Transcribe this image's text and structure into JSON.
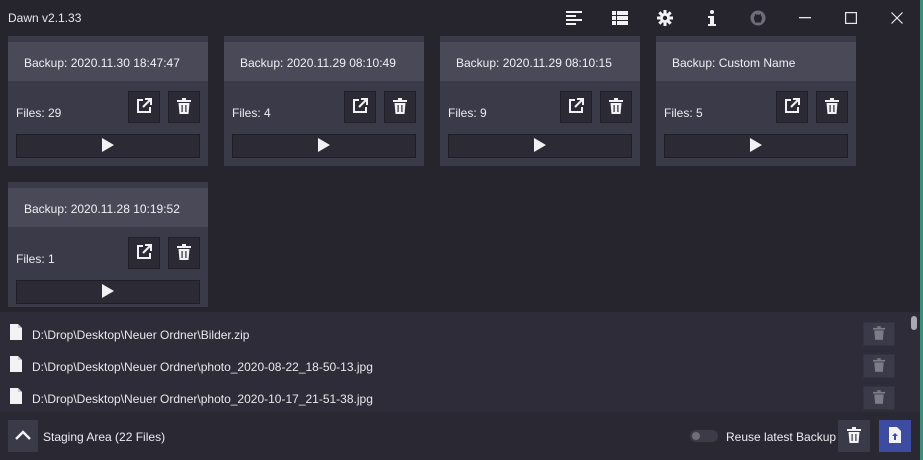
{
  "app": {
    "title": "Dawn v2.1.33"
  },
  "toolbar": {
    "icons": [
      "align-left-icon",
      "list-icon",
      "gear-icon",
      "info-icon",
      "github-icon"
    ]
  },
  "window_controls": [
    "minimize-icon",
    "maximize-icon",
    "close-icon"
  ],
  "backups": [
    {
      "name": "Backup: 2020.11.30 18:47:47",
      "files": "Files: 29"
    },
    {
      "name": "Backup: 2020.11.29 08:10:49",
      "files": "Files: 4"
    },
    {
      "name": "Backup: 2020.11.29 08:10:15",
      "files": "Files: 9"
    },
    {
      "name": "Backup: Custom Name",
      "files": "Files: 5"
    },
    {
      "name": "Backup: 2020.11.28 10:19:52",
      "files": "Files: 1"
    }
  ],
  "staged_files": [
    {
      "path": "D:\\Drop\\Desktop\\Neuer Ordner\\Bilder.zip"
    },
    {
      "path": "D:\\Drop\\Desktop\\Neuer Ordner\\photo_2020-08-22_18-50-13.jpg"
    },
    {
      "path": "D:\\Drop\\Desktop\\Neuer Ordner\\photo_2020-10-17_21-51-38.jpg"
    }
  ],
  "bottom": {
    "staging_label": "Staging Area (22 Files)",
    "reuse_label": "Reuse latest Backup",
    "reuse_enabled": false
  },
  "colors": {
    "background": "#26252e",
    "card": "#3b3a48",
    "card_header": "#4a4958",
    "accent": "#3d4ba0"
  }
}
